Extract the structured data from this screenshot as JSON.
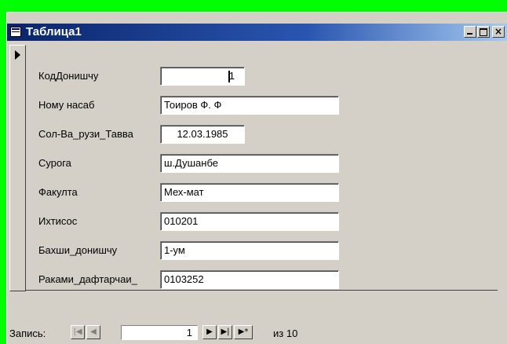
{
  "window": {
    "title": "Таблица1",
    "buttons": {
      "minimize": "_",
      "maximize": "□",
      "close": "×"
    }
  },
  "form": {
    "fields": [
      {
        "label": "КодДонишчу",
        "value": "1"
      },
      {
        "label": "Ному насаб",
        "value": "Тоиров Ф. Ф"
      },
      {
        "label": "Сол-Ва_рузи_Тавва",
        "value": "12.03.1985"
      },
      {
        "label": "Сурога",
        "value": "ш.Душанбе"
      },
      {
        "label": "Факулта",
        "value": "Мех-мат"
      },
      {
        "label": "Ихтисос",
        "value": "010201"
      },
      {
        "label": "Бахши_донишчу",
        "value": "1-ум"
      },
      {
        "label": "Раками_дафтарчаи_",
        "value": "0103252"
      }
    ]
  },
  "navigation": {
    "record_label": "Запись:",
    "current_record": "1",
    "total_text": "из 10",
    "buttons": {
      "first": "|◀",
      "previous": "◀",
      "next": "▶",
      "last": "▶|",
      "new": "▶*"
    }
  },
  "colors": {
    "background": "#00ff00",
    "window": "#d4d0c8",
    "titlebar": "#0a246a"
  },
  "icons": {
    "window_icon": "table-icon",
    "record_selector": "current-record-arrow-icon"
  }
}
